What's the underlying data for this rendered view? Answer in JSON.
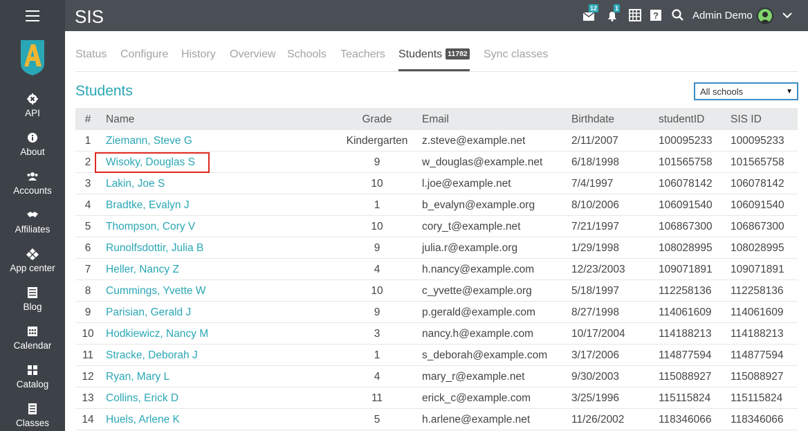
{
  "app": {
    "title": "SIS"
  },
  "sidebar": {
    "items": [
      {
        "label": "API",
        "icon": "gear-icon"
      },
      {
        "label": "About",
        "icon": "info-icon"
      },
      {
        "label": "Accounts",
        "icon": "users-icon"
      },
      {
        "label": "Affiliates",
        "icon": "handshake-icon"
      },
      {
        "label": "App center",
        "icon": "diamond-icon"
      },
      {
        "label": "Blog",
        "icon": "newspaper-icon"
      },
      {
        "label": "Calendar",
        "icon": "calendar-icon"
      },
      {
        "label": "Catalog",
        "icon": "grid-icon"
      },
      {
        "label": "Classes",
        "icon": "book-icon"
      }
    ]
  },
  "topbar": {
    "messages_count": "12",
    "notifications_count": "1",
    "user_name": "Admin Demo"
  },
  "tabs": [
    {
      "label": "Status"
    },
    {
      "label": "Configure"
    },
    {
      "label": "History"
    },
    {
      "label": "Overview"
    },
    {
      "label": "Schools"
    },
    {
      "label": "Teachers"
    },
    {
      "label": "Students",
      "count": "11782",
      "active": true
    },
    {
      "label": "Sync classes"
    }
  ],
  "section": {
    "title": "Students",
    "school_filter": "All schools"
  },
  "table": {
    "headers": {
      "num": "#",
      "name": "Name",
      "grade": "Grade",
      "email": "Email",
      "birthdate": "Birthdate",
      "student_id": "studentID",
      "sis_id": "SIS ID"
    },
    "rows": [
      {
        "num": "1",
        "name": "Ziemann, Steve G",
        "grade": "Kindergarten",
        "email": "z.steve@example.net",
        "birthdate": "2/11/2007",
        "student_id": "100095233",
        "sis_id": "100095233"
      },
      {
        "num": "2",
        "name": "Wisoky, Douglas S",
        "grade": "9",
        "email": "w_douglas@example.net",
        "birthdate": "6/18/1998",
        "student_id": "101565758",
        "sis_id": "101565758"
      },
      {
        "num": "3",
        "name": "Lakin, Joe S",
        "grade": "10",
        "email": "l.joe@example.net",
        "birthdate": "7/4/1997",
        "student_id": "106078142",
        "sis_id": "106078142"
      },
      {
        "num": "4",
        "name": "Bradtke, Evalyn J",
        "grade": "1",
        "email": "b_evalyn@example.org",
        "birthdate": "8/10/2006",
        "student_id": "106091540",
        "sis_id": "106091540"
      },
      {
        "num": "5",
        "name": "Thompson, Cory V",
        "grade": "10",
        "email": "cory_t@example.net",
        "birthdate": "7/21/1997",
        "student_id": "106867300",
        "sis_id": "106867300"
      },
      {
        "num": "6",
        "name": "Runolfsdottir, Julia B",
        "grade": "9",
        "email": "julia.r@example.org",
        "birthdate": "1/29/1998",
        "student_id": "108028995",
        "sis_id": "108028995"
      },
      {
        "num": "7",
        "name": "Heller, Nancy Z",
        "grade": "4",
        "email": "h.nancy@example.com",
        "birthdate": "12/23/2003",
        "student_id": "109071891",
        "sis_id": "109071891"
      },
      {
        "num": "8",
        "name": "Cummings, Yvette W",
        "grade": "10",
        "email": "c_yvette@example.org",
        "birthdate": "5/18/1997",
        "student_id": "112258136",
        "sis_id": "112258136"
      },
      {
        "num": "9",
        "name": "Parisian, Gerald J",
        "grade": "9",
        "email": "p.gerald@example.com",
        "birthdate": "8/27/1998",
        "student_id": "114061609",
        "sis_id": "114061609"
      },
      {
        "num": "10",
        "name": "Hodkiewicz, Nancy M",
        "grade": "3",
        "email": "nancy.h@example.com",
        "birthdate": "10/17/2004",
        "student_id": "114188213",
        "sis_id": "114188213"
      },
      {
        "num": "11",
        "name": "Stracke, Deborah J",
        "grade": "1",
        "email": "s_deborah@example.com",
        "birthdate": "3/17/2006",
        "student_id": "114877594",
        "sis_id": "114877594"
      },
      {
        "num": "12",
        "name": "Ryan, Mary L",
        "grade": "4",
        "email": "mary_r@example.net",
        "birthdate": "9/30/2003",
        "student_id": "115088927",
        "sis_id": "115088927"
      },
      {
        "num": "13",
        "name": "Collins, Erick D",
        "grade": "11",
        "email": "erick_c@example.com",
        "birthdate": "3/25/1996",
        "student_id": "115115824",
        "sis_id": "115115824"
      },
      {
        "num": "14",
        "name": "Huels, Arlene K",
        "grade": "5",
        "email": "h.arlene@example.net",
        "birthdate": "11/26/2002",
        "student_id": "118346066",
        "sis_id": "118346066"
      }
    ]
  },
  "colors": {
    "accent": "#2aa7b5",
    "sidebar_bg": "#3d4248",
    "topbar_bg": "#4a4f55",
    "highlight": "#e0261e"
  }
}
